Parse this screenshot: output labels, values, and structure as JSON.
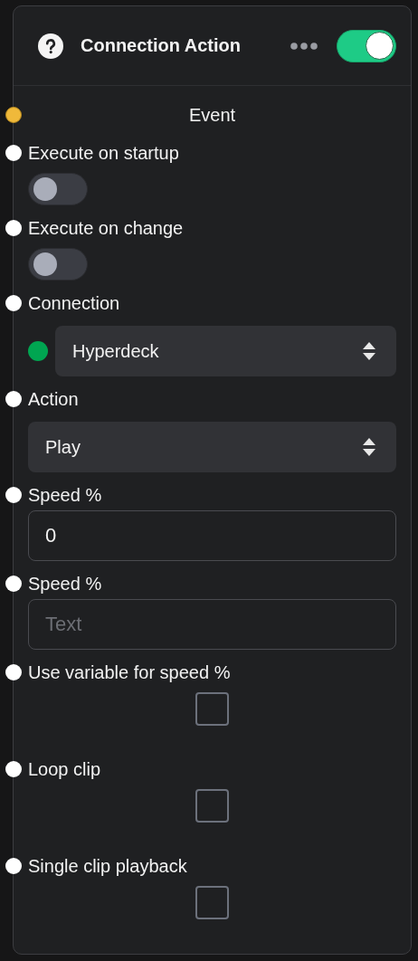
{
  "node": {
    "title": "Connection Action",
    "enabled": true
  },
  "event": {
    "label": "Event"
  },
  "fields": [
    {
      "kind": "toggle",
      "label": "Execute on startup",
      "on": false
    },
    {
      "kind": "toggle",
      "label": "Execute on change",
      "on": false
    },
    {
      "kind": "select",
      "label": "Connection",
      "value": "Hyperdeck",
      "color": "#00a551"
    },
    {
      "kind": "select",
      "label": "Action",
      "value": "Play"
    },
    {
      "kind": "input",
      "label": "Speed %",
      "value": "0"
    },
    {
      "kind": "input",
      "label": "Speed %",
      "placeholder": "Text"
    },
    {
      "kind": "checkbox",
      "label": "Use variable for speed %",
      "checked": false
    },
    {
      "kind": "checkbox",
      "label": "Loop clip",
      "checked": false
    },
    {
      "kind": "checkbox",
      "label": "Single clip playback",
      "checked": false
    }
  ]
}
